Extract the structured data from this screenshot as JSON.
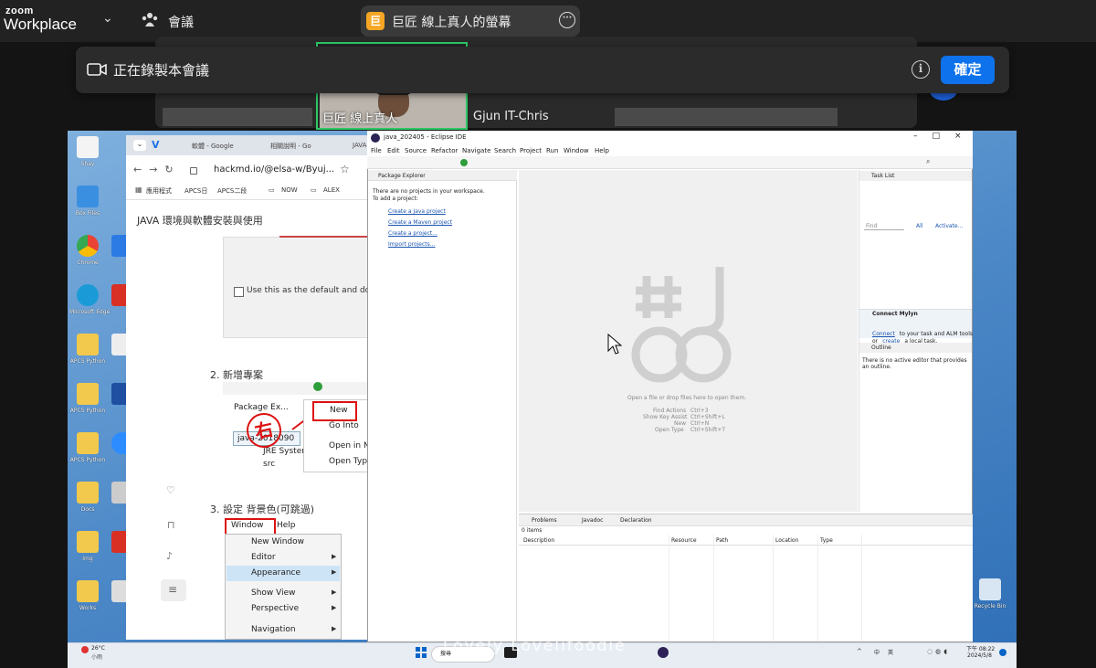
{
  "zoom": {
    "logo_top": "zoom",
    "logo_bottom": "Workplace",
    "meetings_label": "會議",
    "share_badge": "巨",
    "share_title": "巨匠 線上真人的螢幕"
  },
  "participants": {
    "active_name": "巨匠 線上真人",
    "second_name": "Gjun IT-Chris"
  },
  "recording_banner": {
    "text": "正在錄製本會議",
    "info_label": "i",
    "confirm_label": "確定"
  },
  "desktop": {
    "icons": [
      "Shay",
      "Gila",
      "Box Files",
      "Chrome",
      "Microsoft Edge",
      "APCS Python",
      "APCS Python",
      "APCS Python",
      "Docs",
      "Img",
      "Works"
    ],
    "recycle_label": "Recycle Bin"
  },
  "browser": {
    "tabs": [
      "軟體 - Google",
      "相關說明 - Go",
      "JAVA"
    ],
    "url": "hackmd.io/@elsa-w/Byuj...",
    "bookmarks": [
      "應用程式",
      "APCS日",
      "APCS二段",
      "NOW",
      "ALEX"
    ],
    "doc_title": "JAVA 環境與軟體安裝與使用",
    "checkbox_text": "Use this as the default and do n",
    "step2": "2. 新增專案",
    "step3": "3. 設定 背景色(可跳過)",
    "pe_tab": "Package Ex...",
    "context_menu": [
      "New",
      "Go Into",
      "Open in N",
      "Open Typ"
    ],
    "tree_items": [
      "java-2018090",
      "JRE System",
      "src"
    ],
    "window_menu_bar": [
      "Window",
      "Help"
    ],
    "window_menu_items": [
      "New Window",
      "Editor",
      "Appearance",
      "Show View",
      "Perspective",
      "Navigation"
    ],
    "stamp_char": "右"
  },
  "eclipse": {
    "title": "java_202405 - Eclipse IDE",
    "menu": [
      "File",
      "Edit",
      "Source",
      "Refactor",
      "Navigate",
      "Search",
      "Project",
      "Run",
      "Window",
      "Help"
    ],
    "package_explorer_title": "Package Explorer",
    "pe_msg1": "There are no projects in your workspace.",
    "pe_msg2": "To add a project:",
    "pe_links": [
      "Create a Java project",
      "Create a Maven project",
      "Create a project...",
      "Import projects..."
    ],
    "editor_hint": "Open a file or drop files here to open them.",
    "shortcuts": [
      {
        "label": "Find Actions",
        "key": "Ctrl+3"
      },
      {
        "label": "Show Key Assist",
        "key": "Ctrl+Shift+L"
      },
      {
        "label": "New",
        "key": "Ctrl+N"
      },
      {
        "label": "Open Type",
        "key": "Ctrl+Shift+T"
      }
    ],
    "task_list": "Task List",
    "task_find": "Find",
    "task_all": "All",
    "task_activate": "Activate...",
    "mylyn_title": "Connect Mylyn",
    "mylyn_line1_link": "Connect",
    "mylyn_line1_rest": "to your task and ALM tools",
    "mylyn_line2_pre": "or",
    "mylyn_line2_link": "create",
    "mylyn_line2_rest": "a local task.",
    "outline_title": "Outline",
    "outline_msg1": "There is no active editor that provides",
    "outline_msg2": "an outline.",
    "bottom_tabs": [
      "Problems",
      "Javadoc",
      "Declaration"
    ],
    "items_count": "0 items",
    "columns": [
      "Description",
      "Resource",
      "Path",
      "Location",
      "Type"
    ]
  },
  "taskbar": {
    "weather_temp": "26°C",
    "weather_desc": "小雨",
    "search_label": "搜尋",
    "ime1": "中",
    "ime2": "英",
    "time": "下午 08:22",
    "date": "2024/5/8"
  },
  "watermark": {
    "line1": "生活趣",
    "line2": "Lovely Lovelifoodie"
  },
  "colors": {
    "zoom_blue": "#0e72ed",
    "active_speaker_green": "#2ec866",
    "annotation_red": "#d11111"
  }
}
